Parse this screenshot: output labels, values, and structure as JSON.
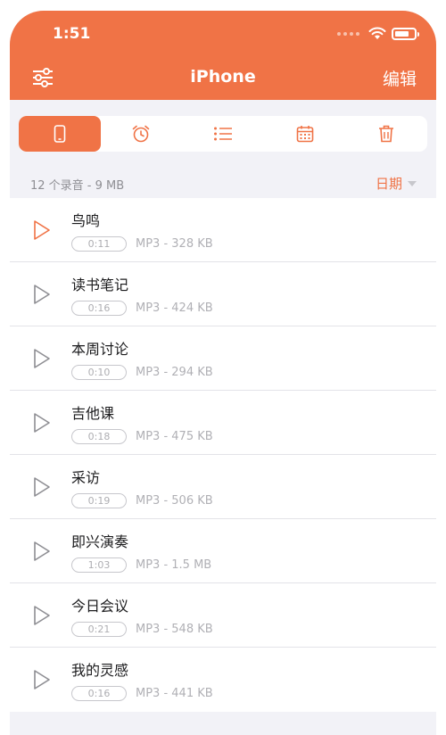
{
  "status_bar": {
    "time": "1:51"
  },
  "nav": {
    "title": "iPhone",
    "edit_label": "编辑"
  },
  "segments": [
    {
      "icon": "phone-icon",
      "active": true
    },
    {
      "icon": "alarm-icon",
      "active": false
    },
    {
      "icon": "list-icon",
      "active": false
    },
    {
      "icon": "calendar-icon",
      "active": false
    },
    {
      "icon": "trash-icon",
      "active": false
    }
  ],
  "summary": {
    "text": "12 个录音 - 9 MB",
    "sort_label": "日期"
  },
  "recordings": [
    {
      "title": "鸟鸣",
      "duration": "0:11",
      "meta": "MP3 - 328 KB",
      "highlighted": true
    },
    {
      "title": "读书笔记",
      "duration": "0:16",
      "meta": "MP3 - 424 KB"
    },
    {
      "title": "本周讨论",
      "duration": "0:10",
      "meta": "MP3 - 294 KB"
    },
    {
      "title": "吉他课",
      "duration": "0:18",
      "meta": "MP3 - 475 KB"
    },
    {
      "title": "采访",
      "duration": "0:19",
      "meta": "MP3 - 506 KB"
    },
    {
      "title": "即兴演奏",
      "duration": "1:03",
      "meta": "MP3 - 1.5 MB"
    },
    {
      "title": "今日会议",
      "duration": "0:21",
      "meta": "MP3 - 548 KB"
    },
    {
      "title": "我的灵感",
      "duration": "0:16",
      "meta": "MP3 - 441 KB"
    }
  ],
  "colors": {
    "accent": "#f07346",
    "background": "#f2f2f7"
  }
}
